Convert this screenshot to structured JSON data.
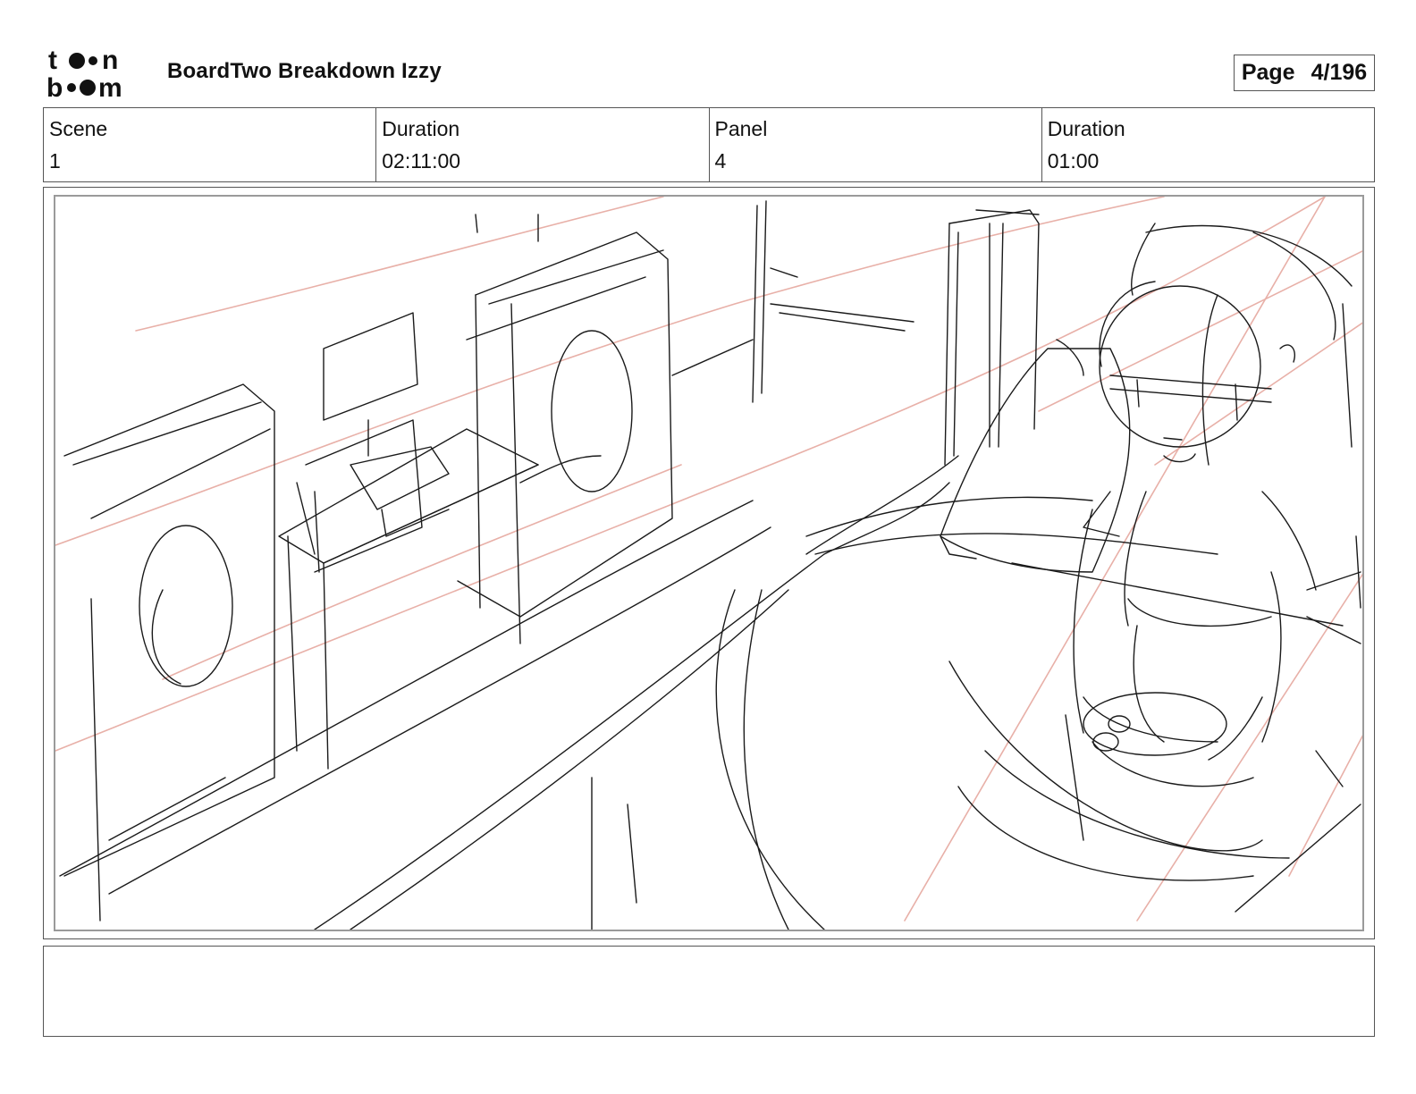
{
  "header": {
    "logo_text_top": "toon",
    "logo_text_bottom": "boom",
    "title": "BoardTwo Breakdown Izzy",
    "page_label": "Page",
    "page_value": "4/196"
  },
  "info": {
    "scene_label": "Scene",
    "scene_value": "1",
    "scene_duration_label": "Duration",
    "scene_duration_value": "02:11:00",
    "panel_label": "Panel",
    "panel_value": "4",
    "panel_duration_label": "Duration",
    "panel_duration_value": "01:00"
  },
  "panel_image": {
    "description_icon": "storyboard-sketch",
    "stroke_color": "#1a1a1a",
    "guide_color": "#e8b0a8"
  },
  "notes": {
    "text": ""
  }
}
